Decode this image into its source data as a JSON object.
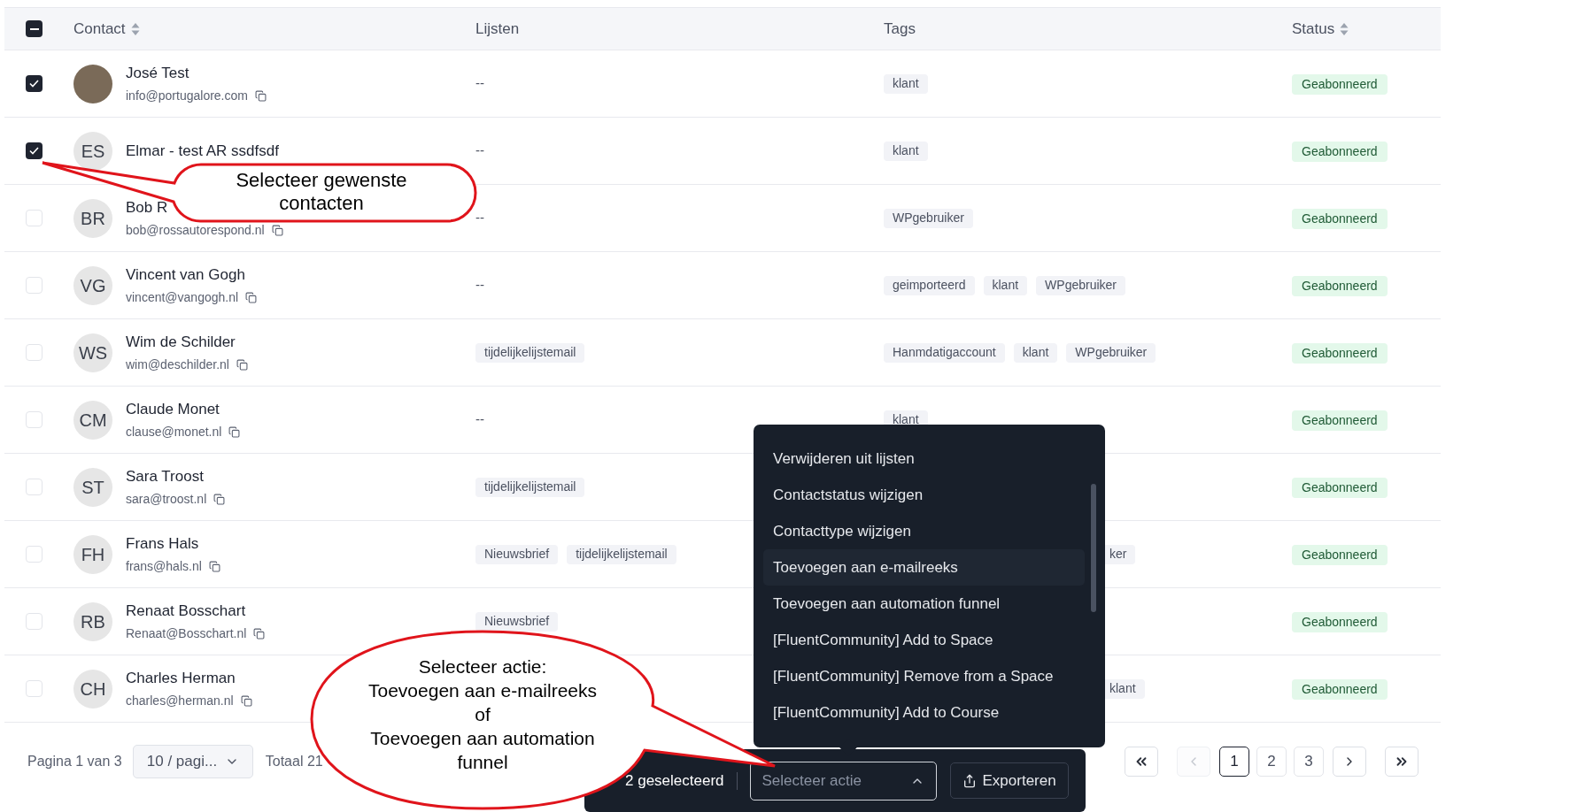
{
  "table": {
    "select_all": {
      "indeterminate": true
    },
    "columns": [
      {
        "label": "Contact",
        "sortable": true
      },
      {
        "label": "Lijsten",
        "sortable": false
      },
      {
        "label": "Tags",
        "sortable": false
      },
      {
        "label": "Status",
        "sortable": true
      }
    ],
    "rows": [
      {
        "checked": true,
        "avatar": {
          "kind": "photo"
        },
        "name": "José Test",
        "email": "info@portugalore.com",
        "lists_placeholder": "--",
        "tags": [
          "klant"
        ],
        "status": "Geabonneerd"
      },
      {
        "checked": true,
        "avatar": {
          "kind": "initials",
          "text": "ES"
        },
        "name": "Elmar - test AR ssdfsdf",
        "lists_placeholder": "--",
        "tags": [
          "klant"
        ],
        "status": "Geabonneerd"
      },
      {
        "checked": false,
        "avatar": {
          "kind": "initials",
          "text": "BR"
        },
        "name": "Bob R",
        "email": "bob@rossautorespond.nl",
        "lists_placeholder": "--",
        "tags": [
          "WPgebruiker"
        ],
        "status": "Geabonneerd"
      },
      {
        "checked": false,
        "avatar": {
          "kind": "initials",
          "text": "VG"
        },
        "name": "Vincent van Gogh",
        "email": "vincent@vangogh.nl",
        "lists_placeholder": "--",
        "tags": [
          "geimporteerd",
          "klant",
          "WPgebruiker"
        ],
        "status": "Geabonneerd"
      },
      {
        "checked": false,
        "avatar": {
          "kind": "initials",
          "text": "WS"
        },
        "name": "Wim de Schilder",
        "email": "wim@deschilder.nl",
        "lists": [
          "tijdelijkelijstemail"
        ],
        "tags": [
          "Hanmdatigaccount",
          "klant",
          "WPgebruiker"
        ],
        "status": "Geabonneerd"
      },
      {
        "checked": false,
        "avatar": {
          "kind": "initials",
          "text": "CM"
        },
        "name": "Claude Monet",
        "email": "clause@monet.nl",
        "lists_placeholder": "--",
        "tags": [
          "klant"
        ],
        "status": "Geabonneerd"
      },
      {
        "checked": false,
        "avatar": {
          "kind": "initials",
          "text": "ST"
        },
        "name": "Sara Troost",
        "email": "sara@troost.nl",
        "lists": [
          "tijdelijkelijstemail"
        ],
        "status": "Geabonneerd"
      },
      {
        "checked": false,
        "avatar": {
          "kind": "initials",
          "text": "FH"
        },
        "name": "Frans Hals",
        "email": "frans@hals.nl",
        "lists": [
          "Nieuwsbrief",
          "tijdelijkelijstemail"
        ],
        "tags_obscured": true,
        "tags": [
          "ker"
        ],
        "status": "Geabonneerd"
      },
      {
        "checked": false,
        "avatar": {
          "kind": "initials",
          "text": "RB"
        },
        "name": "Renaat Bosschart",
        "email": "Renaat@Bosschart.nl",
        "lists": [
          "Nieuwsbrief"
        ],
        "status": "Geabonneerd"
      },
      {
        "checked": false,
        "avatar": {
          "kind": "initials",
          "text": "CH"
        },
        "name": "Charles Herman",
        "email": "charles@herman.nl",
        "tags_obscured": true,
        "tags": [
          "klant"
        ],
        "status": "Geabonneerd"
      }
    ]
  },
  "footer": {
    "page_info": "Pagina 1 van 3",
    "page_size": "10 / pagi...",
    "total": "Totaal 21",
    "pagination": [
      {
        "kind": "first",
        "disabled": false
      },
      {
        "kind": "prev",
        "disabled": true
      },
      {
        "kind": "page",
        "label": "1",
        "selected": true
      },
      {
        "kind": "page",
        "label": "2",
        "selected": false
      },
      {
        "kind": "page",
        "label": "3",
        "selected": false
      },
      {
        "kind": "next",
        "disabled": false
      },
      {
        "kind": "last",
        "disabled": false
      }
    ]
  },
  "action_bar": {
    "selected_count": "2 geselecteerd",
    "action_select": {
      "placeholder": "Selecteer actie",
      "expanded": true
    },
    "export_button": "Exporteren"
  },
  "action_menu": [
    {
      "label": "Verwijderen uit lijsten",
      "highlighted": false
    },
    {
      "label": "Contactstatus wijzigen",
      "highlighted": false
    },
    {
      "label": "Contacttype wijzigen",
      "highlighted": false
    },
    {
      "label": "Toevoegen aan e-mailreeks",
      "highlighted": true
    },
    {
      "label": "Toevoegen aan automation funnel",
      "highlighted": false
    },
    {
      "label": "[FluentCommunity] Add to Space",
      "highlighted": false
    },
    {
      "label": "[FluentCommunity] Remove from a Space",
      "highlighted": false
    },
    {
      "label": "[FluentCommunity] Add to Course",
      "highlighted": false
    }
  ],
  "callouts": [
    {
      "lines": [
        "Selecteer gewenste",
        "contacten"
      ]
    },
    {
      "lines": [
        "Selecteer actie:",
        "Toevoegen aan e-mailreeks",
        "of",
        "Toevoegen aan automation",
        "funnel"
      ]
    }
  ]
}
